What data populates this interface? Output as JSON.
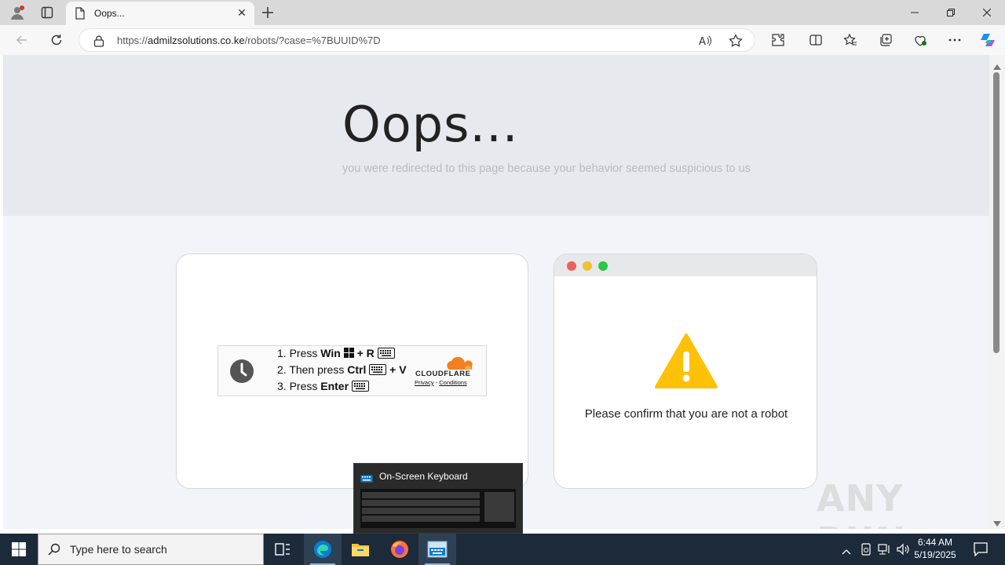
{
  "browser": {
    "tab_title": "Oops...",
    "url_prefix": "https://",
    "url_host": "admilzsolutions.co.ke",
    "url_path": "/robots/?case=%7BUUID%7D"
  },
  "page": {
    "heading": "Oops...",
    "subheading": "you were redirected to this page because your behavior seemed suspicious to us",
    "captcha": {
      "step1_prefix": "1. Press ",
      "step1_key": "Win",
      "step1_plus_r": " + R",
      "step2_prefix": "2. Then press ",
      "step2_key": "Ctrl",
      "step2_plus_v": " + V",
      "step3_prefix": "3. Press ",
      "step3_key": "Enter",
      "brand": "CLOUDFLARE",
      "privacy": "Privacy",
      "separator": " - ",
      "conditions": "Conditions"
    },
    "confirm_text": "Please confirm that you are not a robot"
  },
  "taskbar": {
    "search_placeholder": "Type here to search",
    "time": "6:44 AM",
    "date": "5/19/2025",
    "osk_title": "On-Screen Keyboard"
  },
  "watermark": "ANY RUN",
  "colors": {
    "warning": "#ffc107",
    "dot_red": "#ee5f57",
    "dot_yellow": "#f5bf2f",
    "dot_green": "#28c840",
    "cloudflare_orange": "#f38020",
    "edge_blue": "#0a7cd4"
  }
}
